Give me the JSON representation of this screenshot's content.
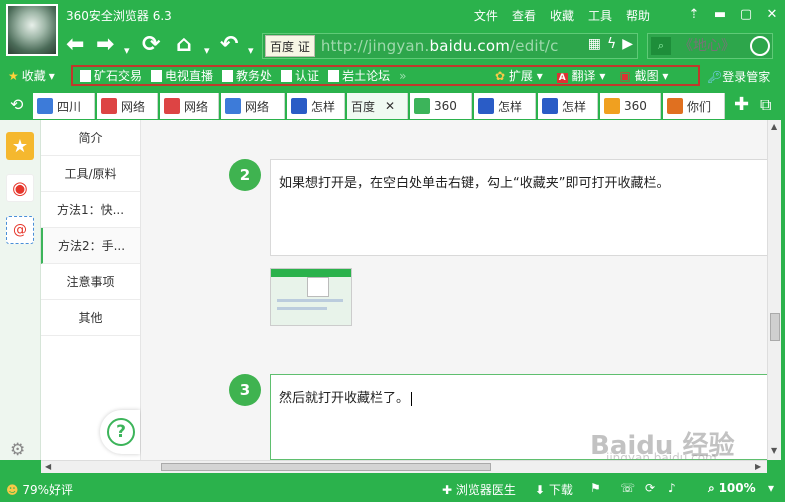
{
  "app": {
    "title": "360安全浏览器 6.3"
  },
  "menu": [
    "文件",
    "查看",
    "收藏",
    "工具",
    "帮助"
  ],
  "address": {
    "badge": "百度 证",
    "url_prefix": "http://jingyan.",
    "url_domain": "baidu.com",
    "url_suffix": "/edit/c"
  },
  "search": {
    "placeholder": "《地心》"
  },
  "favbar": {
    "main": "收藏",
    "items": [
      "矿石交易",
      "电视直播",
      "教务处",
      "认证",
      "岩土论坛"
    ],
    "more": "»",
    "extend": "扩展",
    "translate": "翻译",
    "screenshot": "截图",
    "login": "登录管家"
  },
  "tabs": [
    {
      "label": "四川",
      "color": "#3d7bd9"
    },
    {
      "label": "网络",
      "color": "#d44"
    },
    {
      "label": "网络",
      "color": "#d44"
    },
    {
      "label": "网络",
      "color": "#3d7bd9"
    },
    {
      "label": "怎样",
      "color": "#2a5cc6"
    },
    {
      "label": "百度",
      "color": "#fff"
    },
    {
      "label": "360",
      "color": "#3cb45a"
    },
    {
      "label": "怎样",
      "color": "#2a5cc6"
    },
    {
      "label": "怎样",
      "color": "#2a5cc6"
    },
    {
      "label": "360",
      "color": "#f0a020"
    },
    {
      "label": "你们",
      "color": "#e07020"
    }
  ],
  "sidenav": [
    "简介",
    "工具/原料",
    "方法1：快...",
    "方法2：手...",
    "注意事项",
    "其他"
  ],
  "steps": [
    {
      "num": "2",
      "text": "如果想打开是，在空白处单击右键，勾上“收藏夹”即可打开收藏栏。"
    },
    {
      "num": "3",
      "text": "然后就打开收藏栏了。"
    }
  ],
  "status": {
    "rating": "79%好评",
    "doctor": "浏览器医生",
    "download": "下载",
    "zoom": "100%"
  },
  "watermark": {
    "main": "Baidu 经验",
    "sub": "jingyan.baidu.com"
  }
}
